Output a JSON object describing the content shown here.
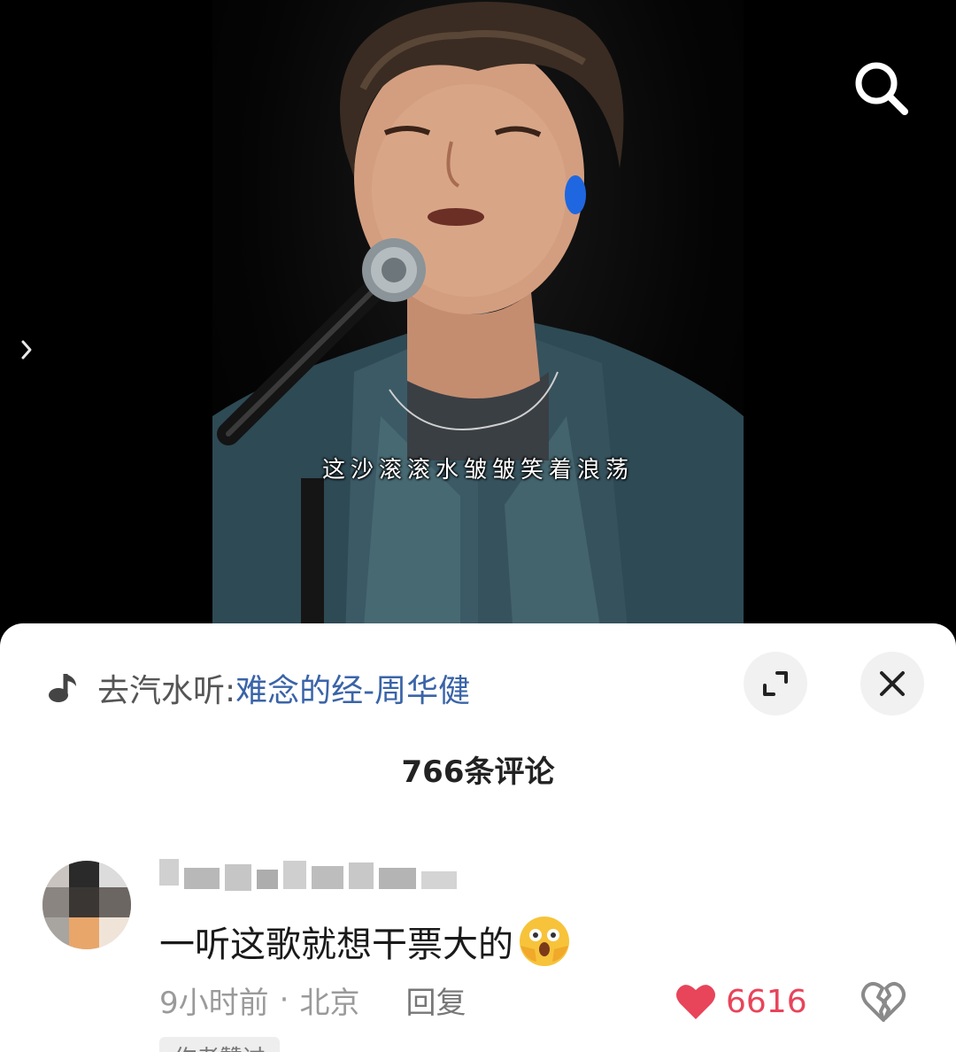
{
  "video": {
    "subtitle": "这沙滚滚水皱皱笑着浪荡"
  },
  "icons": {
    "search": "search-icon",
    "side_arrow": "chevron-right-icon",
    "music": "music-note-icon",
    "expand": "expand-icon",
    "close": "close-icon",
    "like": "heart-icon",
    "dislike": "broken-heart-icon",
    "emoji": "face-with-open-eyes-and-hand-over-mouth-emoji"
  },
  "music": {
    "prefix": "去汽水听: ",
    "title": "难念的经-周华健"
  },
  "comments_header": {
    "count_label": "766条评论"
  },
  "comment": {
    "username_blurred": true,
    "text": "一听这歌就想干票大的",
    "time": "9小时前",
    "dot": "·",
    "location": "北京",
    "reply_label": "回复",
    "like_count": "6616",
    "author_tag": "作者赞过"
  },
  "colors": {
    "accent_link": "#3a64a8",
    "like_red": "#e8445a",
    "meta_gray": "#9a9a9a"
  }
}
